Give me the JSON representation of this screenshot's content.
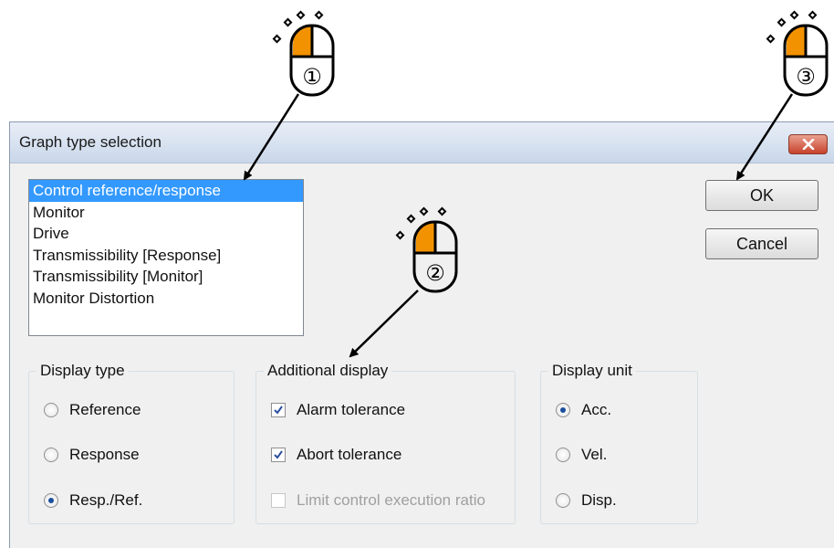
{
  "dialog": {
    "title": "Graph type selection",
    "close_icon": "close-x-icon"
  },
  "graph_types": {
    "selected_index": 0,
    "items": [
      "Control reference/response",
      "Monitor",
      "Drive",
      "Transmissibility [Response]",
      "Transmissibility [Monitor]",
      "Monitor Distortion"
    ]
  },
  "buttons": {
    "ok": "OK",
    "cancel": "Cancel"
  },
  "display_type": {
    "legend": "Display type",
    "options": [
      "Reference",
      "Response",
      "Resp./Ref."
    ],
    "selected": "Resp./Ref."
  },
  "additional_display": {
    "legend": "Additional display",
    "options": [
      {
        "label": "Alarm tolerance",
        "checked": true,
        "enabled": true
      },
      {
        "label": "Abort tolerance",
        "checked": true,
        "enabled": true
      },
      {
        "label": "Limit control execution ratio",
        "checked": false,
        "enabled": false
      }
    ]
  },
  "display_unit": {
    "legend": "Display unit",
    "options": [
      "Acc.",
      "Vel.",
      "Disp."
    ],
    "selected": "Acc."
  },
  "callouts": [
    {
      "label": "①",
      "icon": "mouse-left-click-icon"
    },
    {
      "label": "②",
      "icon": "mouse-left-click-icon"
    },
    {
      "label": "③",
      "icon": "mouse-left-click-icon"
    }
  ],
  "colors": {
    "selection": "#3399ff",
    "mouse_button": "#f39200",
    "close_button": "#c8432d"
  }
}
